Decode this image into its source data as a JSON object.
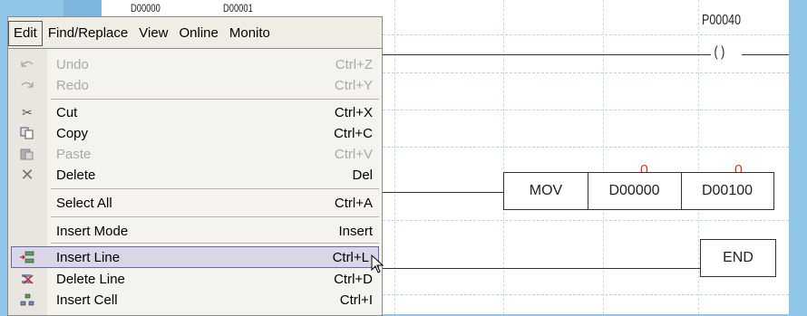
{
  "menubar": {
    "items": [
      {
        "label": "Edit"
      },
      {
        "label": "Find/Replace"
      },
      {
        "label": "View"
      },
      {
        "label": "Online"
      },
      {
        "label": "Monito"
      }
    ]
  },
  "edit_menu": {
    "items": [
      {
        "label": "Undo",
        "shortcut": "Ctrl+Z",
        "icon": "undo-icon",
        "enabled": false
      },
      {
        "label": "Redo",
        "shortcut": "Ctrl+Y",
        "icon": "redo-icon",
        "enabled": false
      },
      {
        "label": "Cut",
        "shortcut": "Ctrl+X",
        "icon": "scissors-icon",
        "enabled": true
      },
      {
        "label": "Copy",
        "shortcut": "Ctrl+C",
        "icon": "copy-icon",
        "enabled": true
      },
      {
        "label": "Paste",
        "shortcut": "Ctrl+V",
        "icon": "paste-icon",
        "enabled": false
      },
      {
        "label": "Delete",
        "shortcut": "Del",
        "icon": "delete-x-icon",
        "enabled": true
      },
      {
        "label": "Select All",
        "shortcut": "Ctrl+A",
        "enabled": true
      },
      {
        "label": "Insert Mode",
        "shortcut": "Insert",
        "enabled": true
      },
      {
        "label": "Insert Line",
        "shortcut": "Ctrl+L",
        "icon": "insert-line-icon",
        "enabled": true,
        "highlighted": true
      },
      {
        "label": "Delete Line",
        "shortcut": "Ctrl+D",
        "icon": "delete-line-icon",
        "enabled": true
      },
      {
        "label": "Insert Cell",
        "shortcut": "Ctrl+I",
        "icon": "insert-cell-icon",
        "enabled": true
      }
    ]
  },
  "ladder": {
    "contact_labels": [
      "D00000",
      "D00001"
    ],
    "coil": {
      "address": "P00040",
      "symbol": "( )"
    },
    "mov_block": {
      "instruction": "MOV",
      "source": "D00000",
      "dest": "D00100",
      "source_value": "0",
      "dest_value": "0"
    },
    "end_block": {
      "label": "END"
    }
  },
  "colors": {
    "accent": "#d83b1f",
    "background": "#8fc6e8",
    "highlight": "#d9d6e8"
  }
}
